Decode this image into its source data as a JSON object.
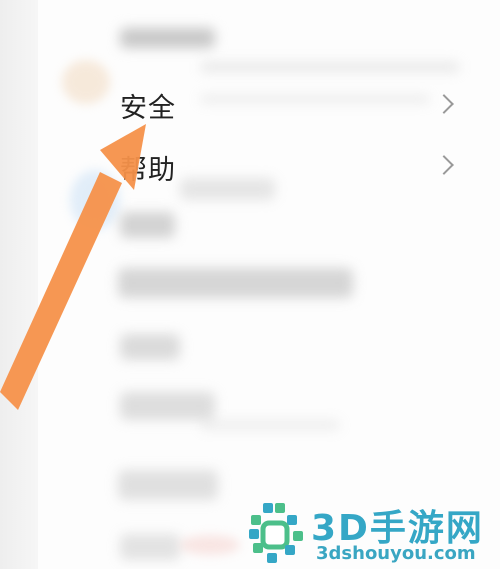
{
  "menu": {
    "items": [
      {
        "label": "安全",
        "has_chevron": true
      },
      {
        "label": "帮助",
        "has_chevron": true
      }
    ]
  },
  "watermark": {
    "title": "3D手游网",
    "site": "3dshouyou.com"
  },
  "colors": {
    "arrow": "#f5914a",
    "watermark": "#35a7c6",
    "watermark_logo_green": "#4cbf8a"
  },
  "icons": [
    "chevron-right-icon",
    "pointer-arrow-icon",
    "logo-icon"
  ]
}
